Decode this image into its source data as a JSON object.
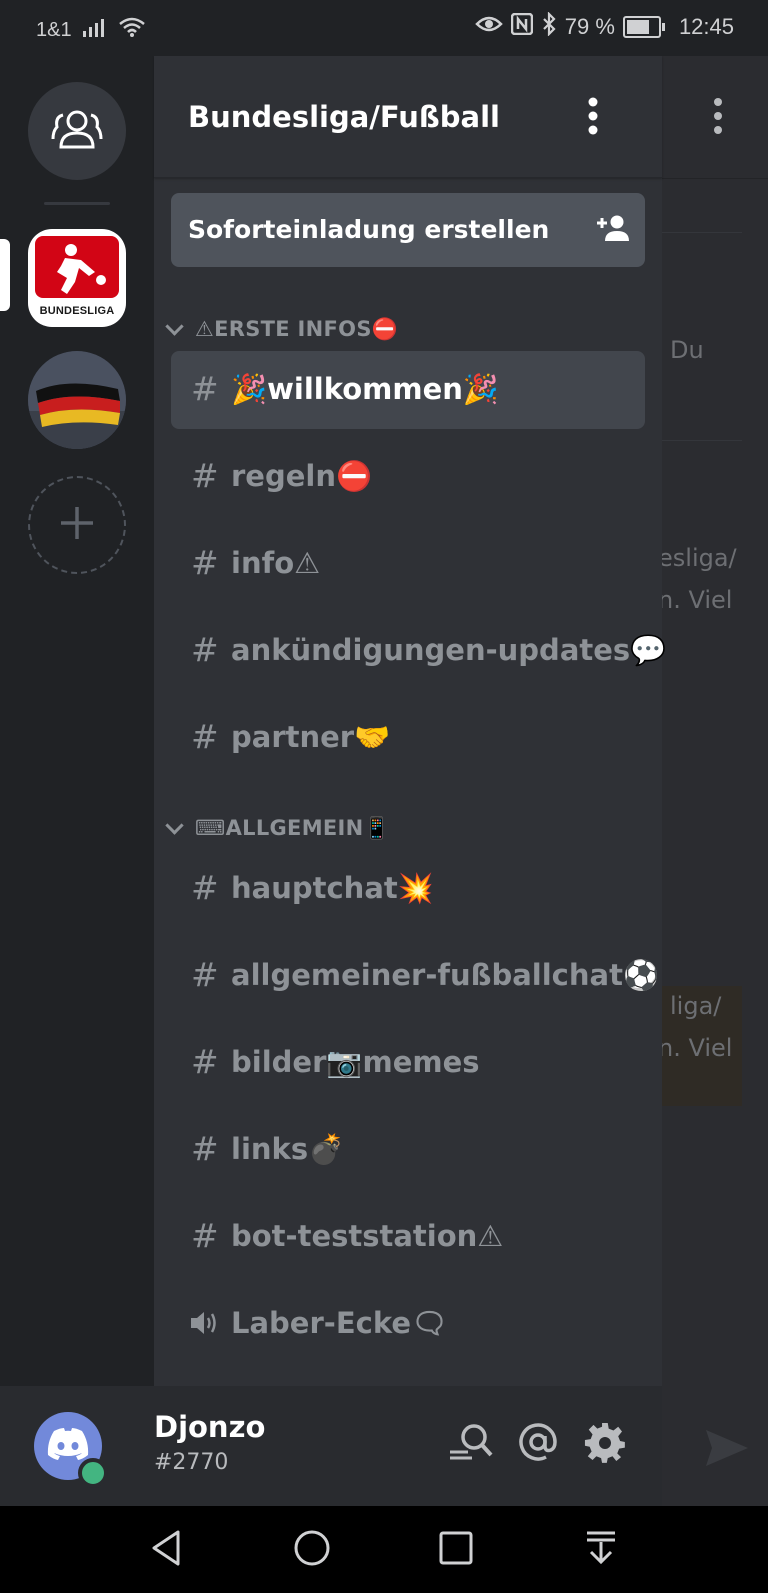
{
  "status_bar": {
    "carrier": "1&1",
    "battery_percent": "79 %",
    "battery_level": 0.79,
    "time": "12:45",
    "icons": [
      "signal-icon",
      "wifi-icon",
      "eye-icon",
      "nfc-icon",
      "bluetooth-icon",
      "battery-icon"
    ]
  },
  "guilds": {
    "items": [
      {
        "name": "direct-messages",
        "icon": "people-icon"
      },
      {
        "name": "Bundesliga",
        "logo_text": "BUNDESLIGA",
        "selected": true
      },
      {
        "name": "germany-flag-server",
        "icon": "flag-image"
      },
      {
        "name": "add-server",
        "icon": "plus-icon"
      }
    ]
  },
  "server": {
    "name": "Bundesliga/Fußball",
    "invite_label": "Soforteinladung erstellen"
  },
  "categories": [
    {
      "label": "⚠ERSTE INFOS⛔",
      "channels": [
        {
          "prefix": "#",
          "label": "🎉willkommen🎉",
          "active": true
        },
        {
          "prefix": "#",
          "label": "regeln⛔"
        },
        {
          "prefix": "#",
          "label": "info⚠"
        },
        {
          "prefix": "#",
          "label": "ankündigungen-updates💬"
        },
        {
          "prefix": "#",
          "label": "partner🤝"
        }
      ]
    },
    {
      "label": "⌨ALLGEMEIN📱",
      "channels": [
        {
          "prefix": "#",
          "label": "hauptchat💥"
        },
        {
          "prefix": "#",
          "label": "allgemeiner-fußballchat⚽"
        },
        {
          "prefix": "#",
          "label": "bilder📷memes"
        },
        {
          "prefix": "#",
          "label": "links💣"
        },
        {
          "prefix": "#",
          "label": "bot-teststation⚠"
        },
        {
          "prefix": "voice",
          "label": "Laber-Ecke🗨"
        }
      ]
    }
  ],
  "user": {
    "name": "Djonzo",
    "discriminator": "#2770",
    "status": "online"
  },
  "background_chat": {
    "fragments": [
      "Du",
      "esliga/",
      "n. Viel",
      "liga/",
      "n. Viel"
    ]
  },
  "colors": {
    "accent": "#7289da",
    "online": "#43b581",
    "drawer": "#2f3136",
    "guild_bar": "#202225",
    "bundesliga_red": "#d20515"
  }
}
